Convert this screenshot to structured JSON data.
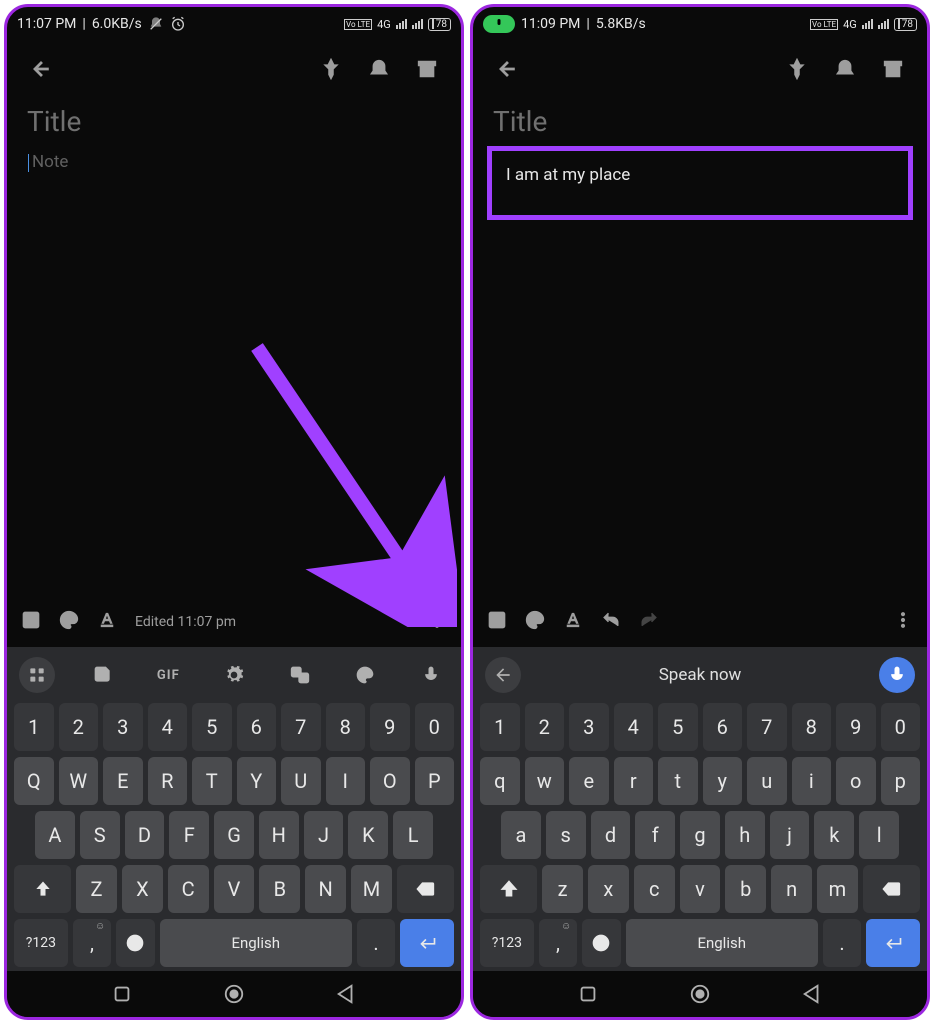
{
  "left": {
    "status": {
      "time": "11:07 PM",
      "speed": "6.0KB/s",
      "net_label": "4G",
      "volte": "Vo LTE",
      "battery": "78"
    },
    "title_placeholder": "Title",
    "note_placeholder": "Note",
    "edited": "Edited 11:07 pm",
    "kb_toolbar_gif": "GIF",
    "kb": {
      "row_num": [
        "1",
        "2",
        "3",
        "4",
        "5",
        "6",
        "7",
        "8",
        "9",
        "0"
      ],
      "row1": [
        "Q",
        "W",
        "E",
        "R",
        "T",
        "Y",
        "U",
        "I",
        "O",
        "P"
      ],
      "row2": [
        "A",
        "S",
        "D",
        "F",
        "G",
        "H",
        "J",
        "K",
        "L"
      ],
      "row3": [
        "Z",
        "X",
        "C",
        "V",
        "B",
        "N",
        "M"
      ],
      "sym": "?123",
      "comma": ",",
      "space": "English",
      "period": "."
    }
  },
  "right": {
    "status": {
      "time": "11:09 PM",
      "speed": "5.8KB/s",
      "net_label": "4G",
      "volte": "Vo LTE",
      "battery": "78"
    },
    "title_placeholder": "Title",
    "note_text": "I am at my place",
    "speak_label": "Speak now",
    "kb": {
      "row_num": [
        "1",
        "2",
        "3",
        "4",
        "5",
        "6",
        "7",
        "8",
        "9",
        "0"
      ],
      "row1": [
        "q",
        "w",
        "e",
        "r",
        "t",
        "y",
        "u",
        "i",
        "o",
        "p"
      ],
      "row2": [
        "a",
        "s",
        "d",
        "f",
        "g",
        "h",
        "j",
        "k",
        "l"
      ],
      "row3": [
        "z",
        "x",
        "c",
        "v",
        "b",
        "n",
        "m"
      ],
      "sym": "?123",
      "comma": ",",
      "space": "English",
      "period": "."
    }
  }
}
